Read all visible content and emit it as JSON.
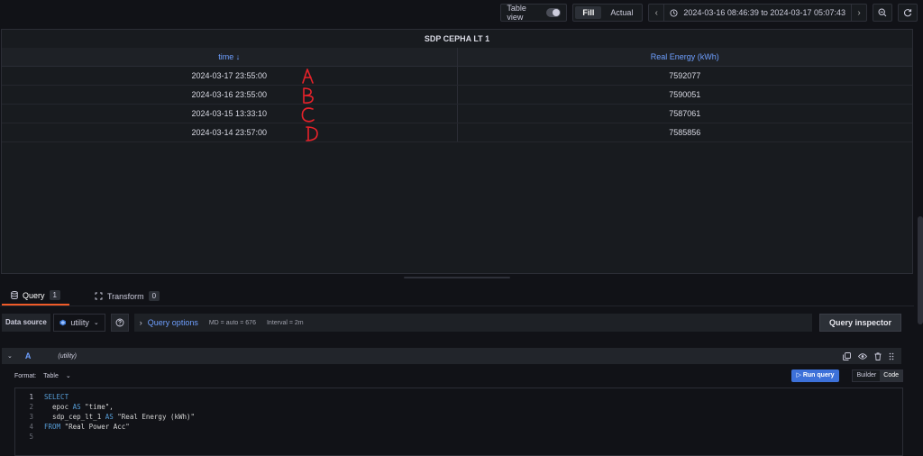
{
  "toolbar": {
    "table_view_label": "Table view",
    "fill_label": "Fill",
    "actual_label": "Actual",
    "time_range": "2024-03-16 08:46:39 to 2024-03-17 05:07:43"
  },
  "panel": {
    "title": "SDP CEPHA LT 1",
    "columns": [
      "time ↓",
      "Real Energy (kWh)"
    ],
    "rows": [
      {
        "time": "2024-03-17 23:55:00",
        "value": "7592077",
        "annotation": "A"
      },
      {
        "time": "2024-03-16 23:55:00",
        "value": "7590051",
        "annotation": "B"
      },
      {
        "time": "2024-03-15 13:33:10",
        "value": "7587061",
        "annotation": "C"
      },
      {
        "time": "2024-03-14 23:57:00",
        "value": "7585856",
        "annotation": "D"
      }
    ]
  },
  "tabs": [
    {
      "label": "Query",
      "count": "1"
    },
    {
      "label": "Transform",
      "count": "0"
    }
  ],
  "datasource": {
    "label": "Data source",
    "selected": "utility",
    "query_options_label": "Query options",
    "md": "MD = auto = 676",
    "interval": "Interval = 2m",
    "inspector_label": "Query inspector"
  },
  "query": {
    "ref_id": "A",
    "ds_name": "(utility)",
    "format_label": "Format:",
    "format_value": "Table",
    "run_label": "Run query",
    "builder_label": "Builder",
    "code_label": "Code"
  },
  "editor": {
    "line_numbers": [
      "1",
      "2",
      "3",
      "4",
      "5"
    ],
    "lines": {
      "l1_kw": "SELECT",
      "l2_a": "  epoc ",
      "l2_kw": "AS",
      "l2_b": " \"time\",",
      "l3_a": "  sdp_cep_lt_1 ",
      "l3_kw": "AS",
      "l3_b": " \"Real Energy (kWh)\"",
      "l4_kw": "FROM",
      "l4_b": " \"Real Power Acc\""
    }
  },
  "colors": {
    "accent_blue": "#6e9fff",
    "tab_active": "#f05a28",
    "run_button": "#3d71d9",
    "annotation_red": "#e8222a"
  }
}
